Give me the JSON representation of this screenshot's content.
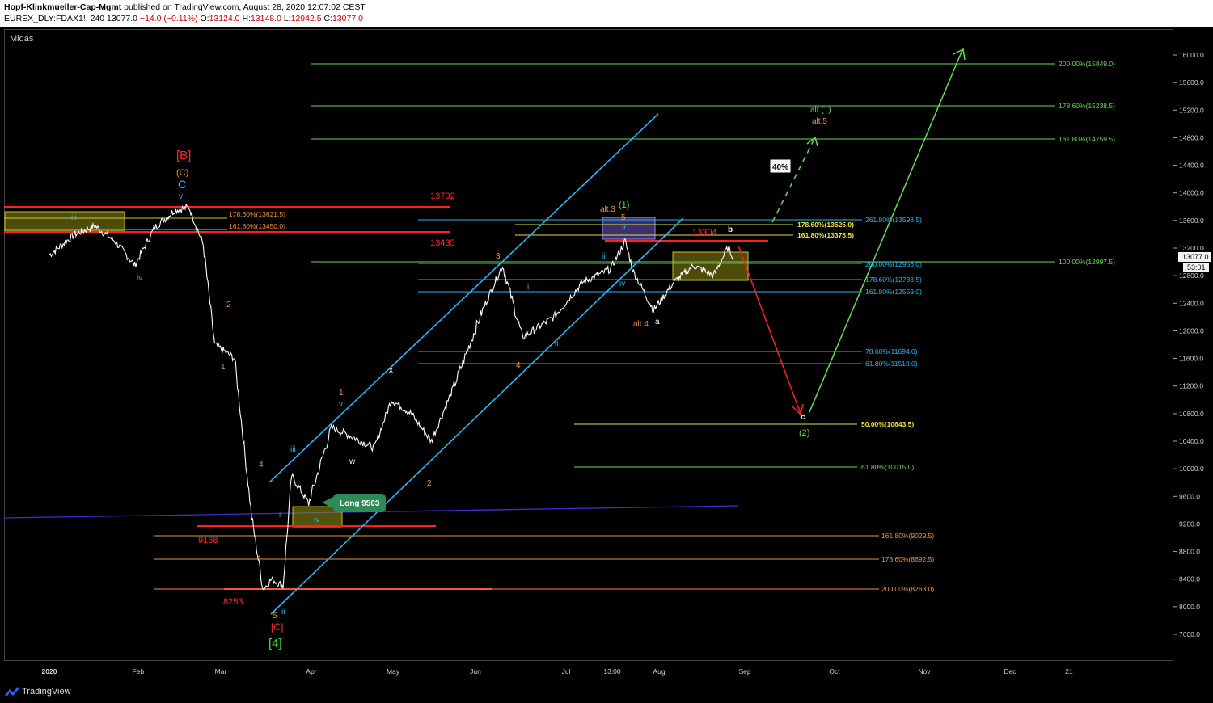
{
  "header": {
    "publisher": "Hopf-Klinkmueller-Cap-Mgmt",
    "published_text": "published on TradingView.com, August 28, 2020 12:07:02 CEST",
    "symbol": "EUREX_DLY:FDAX1!, 240",
    "last": "13077.0",
    "change": "−14.0 (−0.11%)",
    "ohlc": {
      "o_label": "O:",
      "o": "13124.0",
      "h_label": "H:",
      "h": "13148.0",
      "l_label": "L:",
      "l": "12942.5",
      "c_label": "C:",
      "c": "13077.0"
    }
  },
  "indicator_label": "Midas",
  "footer": {
    "brand": "TradingView"
  },
  "colors": {
    "background": "#000000",
    "price": "#ffffff",
    "channel": "#29b6f6",
    "resistance": "#ff1a1a",
    "fib_green": "#66dd55",
    "fib_yellow": "#f0e23c",
    "fib_orange": "#f0923c",
    "fib_blue": "#29b6f6",
    "midas": "#3d2fd6"
  },
  "y_axis": {
    "ticks": [
      "16000.0",
      "15600.0",
      "15200.0",
      "14800.0",
      "14400.0",
      "14000.0",
      "13600.0",
      "13200.0",
      "12800.0",
      "12400.0",
      "12000.0",
      "11600.0",
      "11200.0",
      "10800.0",
      "10400.0",
      "10000.0",
      "9600.0",
      "9200.0",
      "8800.0",
      "8400.0",
      "8000.0",
      "7600.0"
    ],
    "current_price": "13077.0",
    "countdown": "53:01"
  },
  "x_axis": {
    "ticks": [
      "2020",
      "Feb",
      "Mar",
      "Apr",
      "May",
      "Jun",
      "Jul",
      "13:00",
      "Aug",
      "Sep",
      "Oct",
      "Nov",
      "Dec",
      "21"
    ]
  },
  "annotations": {
    "fib_right": [
      "200.00%(15849.0)",
      "178.60%(15238.5)",
      "161.80%(14759.5)",
      "100.00%(12997.5)"
    ],
    "fib_mid_blue": [
      "261.80%(13598.5)",
      "200.00%(12956.0)",
      "178.60%(12733.5)",
      "161.80%(12559.0)",
      "78.60%(11694.0)",
      "61.80%(11519.0)"
    ],
    "fib_mid_yellow": [
      "178.60%(13525.0)",
      "161.80%(13375.5)"
    ],
    "fib_low": [
      "50.00%(10643.5)",
      "61.80%(10015.0)"
    ],
    "fib_orange": [
      "161.80%(9029.5)",
      "178.60%(8692.5)",
      "200.00%(8263.0)"
    ],
    "fib_top_left": [
      "178.60%(13621.5)",
      "161.80%(13450.0)"
    ],
    "levels_red": [
      "13792",
      "13435",
      "13304",
      "9168",
      "8253"
    ],
    "long_label": "Long 9503",
    "percent_box": "40%",
    "wave_labels": {
      "B_bracket": "[B]",
      "C_paren": "(C)",
      "C": "C",
      "v_top": "v",
      "iii_left": "iii",
      "iv_left": "iv",
      "two_orange": "2",
      "one_orange": "1",
      "four_orange": "4",
      "three_orange": "3",
      "five_orange": "5",
      "i_blue": "i",
      "ii_blue": "ii",
      "iii_blue": "iii",
      "iv_blue": "iv",
      "C_bracket": "[C]",
      "four_bracket": "[4]",
      "one_apr": "1",
      "v_apr": "v",
      "w": "w",
      "x": "x",
      "two_may": "2",
      "three_jun": "3",
      "i_jun": "i",
      "ii_jul": "ii",
      "four_jun": "4",
      "iii_jul": "iii",
      "iv_jul": "iv",
      "five_jul": "5",
      "v_jul": "v",
      "one_green": "(1)",
      "alt3": "alt.3",
      "alt4": "alt.4",
      "a": "a",
      "b": "b",
      "c": "c",
      "two_green": "(2)",
      "alt1": "alt.(1)",
      "alt5": "alt.5"
    }
  },
  "chart_data": {
    "type": "line",
    "title": "",
    "xlabel": "",
    "ylabel": "",
    "ylim": [
      7400,
      16300
    ],
    "series": [
      {
        "values_approx": [
          [
            "2020-01-01",
            13100
          ],
          [
            "2020-01-10",
            13400
          ],
          [
            "2020-01-17",
            13520
          ],
          [
            "2020-01-24",
            13300
          ],
          [
            "2020-01-31",
            12950
          ],
          [
            "2020-02-07",
            13500
          ],
          [
            "2020-02-14",
            13750
          ],
          [
            "2020-02-19",
            13792
          ],
          [
            "2020-02-24",
            13250
          ],
          [
            "2020-02-28",
            11800
          ],
          [
            "2020-03-06",
            11600
          ],
          [
            "2020-03-12",
            9300
          ],
          [
            "2020-03-16",
            8253
          ],
          [
            "2020-03-19",
            8400
          ],
          [
            "2020-03-23",
            8300
          ],
          [
            "2020-03-26",
            9900
          ],
          [
            "2020-04-01",
            9500
          ],
          [
            "2020-04-09",
            10600
          ],
          [
            "2020-04-17",
            10450
          ],
          [
            "2020-04-24",
            10300
          ],
          [
            "2020-04-30",
            11000
          ],
          [
            "2020-05-07",
            10800
          ],
          [
            "2020-05-14",
            10400
          ],
          [
            "2020-05-22",
            11200
          ],
          [
            "2020-06-01",
            12300
          ],
          [
            "2020-06-08",
            12950
          ],
          [
            "2020-06-15",
            11900
          ],
          [
            "2020-06-26",
            12200
          ],
          [
            "2020-07-06",
            12700
          ],
          [
            "2020-07-16",
            12900
          ],
          [
            "2020-07-21",
            13300
          ],
          [
            "2020-07-24",
            12850
          ],
          [
            "2020-07-31",
            12300
          ],
          [
            "2020-08-07",
            12700
          ],
          [
            "2020-08-14",
            12950
          ],
          [
            "2020-08-21",
            12800
          ],
          [
            "2020-08-26",
            13200
          ],
          [
            "2020-08-28",
            13077
          ]
        ]
      }
    ],
    "projections": [
      {
        "from": [
          "2020-08-28",
          13300
        ],
        "to": [
          "2020-09-24",
          10750
        ],
        "color": "red"
      },
      {
        "from": [
          "2020-09-24",
          10750
        ],
        "to": [
          "2020-11-17",
          15800
        ],
        "color": "green"
      },
      {
        "from": [
          "2020-09-05",
          13400
        ],
        "to": [
          "2020-10-07",
          14800
        ],
        "color": "green",
        "dashed": true
      }
    ]
  }
}
